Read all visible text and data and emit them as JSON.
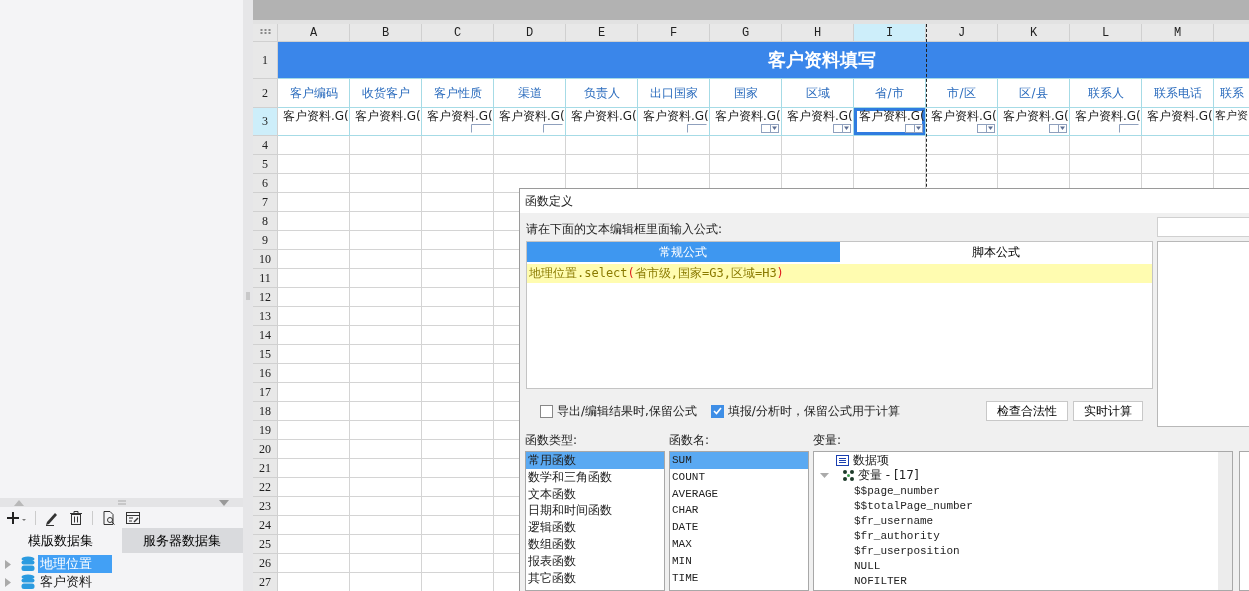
{
  "left_panel": {
    "tabs": [
      {
        "label": "模版数据集",
        "selected": true
      },
      {
        "label": "服务器数据集",
        "selected": false
      }
    ],
    "datasets": [
      {
        "name": "地理位置",
        "selected": true
      },
      {
        "name": "客户资料",
        "selected": false
      }
    ]
  },
  "sheet": {
    "columns": [
      {
        "label": "A",
        "selected": false
      },
      {
        "label": "B",
        "selected": false
      },
      {
        "label": "C",
        "selected": false
      },
      {
        "label": "D",
        "selected": false
      },
      {
        "label": "E",
        "selected": false
      },
      {
        "label": "F",
        "selected": false
      },
      {
        "label": "G",
        "selected": false
      },
      {
        "label": "H",
        "selected": false
      },
      {
        "label": "I",
        "selected": true
      },
      {
        "label": "J",
        "selected": false
      },
      {
        "label": "K",
        "selected": false
      },
      {
        "label": "L",
        "selected": false
      },
      {
        "label": "M",
        "selected": false
      }
    ],
    "rows": [
      {
        "label": "1",
        "selected": false
      },
      {
        "label": "2",
        "selected": false
      },
      {
        "label": "3",
        "selected": true
      },
      {
        "label": "4",
        "selected": false
      },
      {
        "label": "5",
        "selected": false
      },
      {
        "label": "6",
        "selected": false
      },
      {
        "label": "7",
        "selected": false
      },
      {
        "label": "8",
        "selected": false
      },
      {
        "label": "9",
        "selected": false
      },
      {
        "label": "10",
        "selected": false
      },
      {
        "label": "11",
        "selected": false
      },
      {
        "label": "12",
        "selected": false
      },
      {
        "label": "13",
        "selected": false
      },
      {
        "label": "14",
        "selected": false
      },
      {
        "label": "15",
        "selected": false
      },
      {
        "label": "16",
        "selected": false
      },
      {
        "label": "17",
        "selected": false
      },
      {
        "label": "18",
        "selected": false
      },
      {
        "label": "19",
        "selected": false
      },
      {
        "label": "20",
        "selected": false
      },
      {
        "label": "21",
        "selected": false
      },
      {
        "label": "22",
        "selected": false
      },
      {
        "label": "23",
        "selected": false
      },
      {
        "label": "24",
        "selected": false
      },
      {
        "label": "25",
        "selected": false
      },
      {
        "label": "26",
        "selected": false
      },
      {
        "label": "27",
        "selected": false
      }
    ],
    "title": "客户资料填写",
    "headers": [
      "客户编码",
      "收货客户",
      "客户性质",
      "渠道",
      "负责人",
      "出口国家",
      "国家",
      "区域",
      "省/市",
      "市/区",
      "区/县",
      "联系人",
      "联系电话",
      "联系"
    ],
    "bindings": [
      {
        "text": "客户资料.G(",
        "kind": "plain",
        "selected": false
      },
      {
        "text": "客户资料.G(",
        "kind": "plain",
        "selected": false
      },
      {
        "text": "客户资料.G(",
        "kind": "textbox",
        "selected": false
      },
      {
        "text": "客户资料.G(",
        "kind": "textbox",
        "selected": false
      },
      {
        "text": "客户资料.G(",
        "kind": "plain",
        "selected": false
      },
      {
        "text": "客户资料.G(",
        "kind": "textbox",
        "selected": false
      },
      {
        "text": "客户资料.G(",
        "kind": "dropdown",
        "selected": false
      },
      {
        "text": "客户资料.G(",
        "kind": "dropdown",
        "selected": false
      },
      {
        "text": "客户资料.G(",
        "kind": "dropdown",
        "selected": true
      },
      {
        "text": "客户资料.G(",
        "kind": "dropdown",
        "selected": false
      },
      {
        "text": "客户资料.G(",
        "kind": "dropdown",
        "selected": false
      },
      {
        "text": "客户资料.G(",
        "kind": "textbox",
        "selected": false
      },
      {
        "text": "客户资料.G(",
        "kind": "plain",
        "selected": false
      },
      {
        "text": "客户资",
        "kind": "plain",
        "selected": false
      }
    ]
  },
  "dialog": {
    "title": "函数定义",
    "prompt": "请在下面的文本编辑框里面输入公式:",
    "tabs": [
      {
        "label": "常规公式",
        "selected": true
      },
      {
        "label": "脚本公式",
        "selected": false
      }
    ],
    "formula": [
      {
        "kind": "name",
        "text": "地理位置.select"
      },
      {
        "kind": "paren",
        "text": "("
      },
      {
        "kind": "arg",
        "text": "省市级,国家=G3,区域=H3"
      },
      {
        "kind": "paren",
        "text": ")"
      }
    ],
    "options": [
      {
        "label": "导出/编辑结果时,保留公式",
        "checked": false
      },
      {
        "label": "填报/分析时，保留公式用于计算",
        "checked": true
      }
    ],
    "buttons": [
      "检查合法性",
      "实时计算"
    ],
    "function_types": {
      "label": "函数类型:",
      "items": [
        {
          "label": "常用函数",
          "selected": true
        },
        {
          "label": "数学和三角函数",
          "selected": false
        },
        {
          "label": "文本函数",
          "selected": false
        },
        {
          "label": "日期和时间函数",
          "selected": false
        },
        {
          "label": "逻辑函数",
          "selected": false
        },
        {
          "label": "数组函数",
          "selected": false
        },
        {
          "label": "报表函数",
          "selected": false
        },
        {
          "label": "其它函数",
          "selected": false
        }
      ]
    },
    "function_names": {
      "label": "函数名:",
      "items": [
        {
          "label": "SUM",
          "selected": true
        },
        {
          "label": "COUNT",
          "selected": false
        },
        {
          "label": "AVERAGE",
          "selected": false
        },
        {
          "label": "CHAR",
          "selected": false
        },
        {
          "label": "DATE",
          "selected": false
        },
        {
          "label": "MAX",
          "selected": false
        },
        {
          "label": "MIN",
          "selected": false
        },
        {
          "label": "TIME",
          "selected": false
        }
      ]
    },
    "variables": {
      "label": "变量:",
      "items": [
        {
          "label": "数据项",
          "kind": "dataitem"
        },
        {
          "label": "变量 - [17]",
          "kind": "group",
          "expanded": true,
          "children": [
            {
              "label": "$$page_number"
            },
            {
              "label": "$$totalPage_number"
            },
            {
              "label": "$fr_username"
            },
            {
              "label": "$fr_authority"
            },
            {
              "label": "$fr_userposition"
            },
            {
              "label": "NULL"
            },
            {
              "label": "NOFILTER"
            }
          ]
        }
      ]
    }
  }
}
